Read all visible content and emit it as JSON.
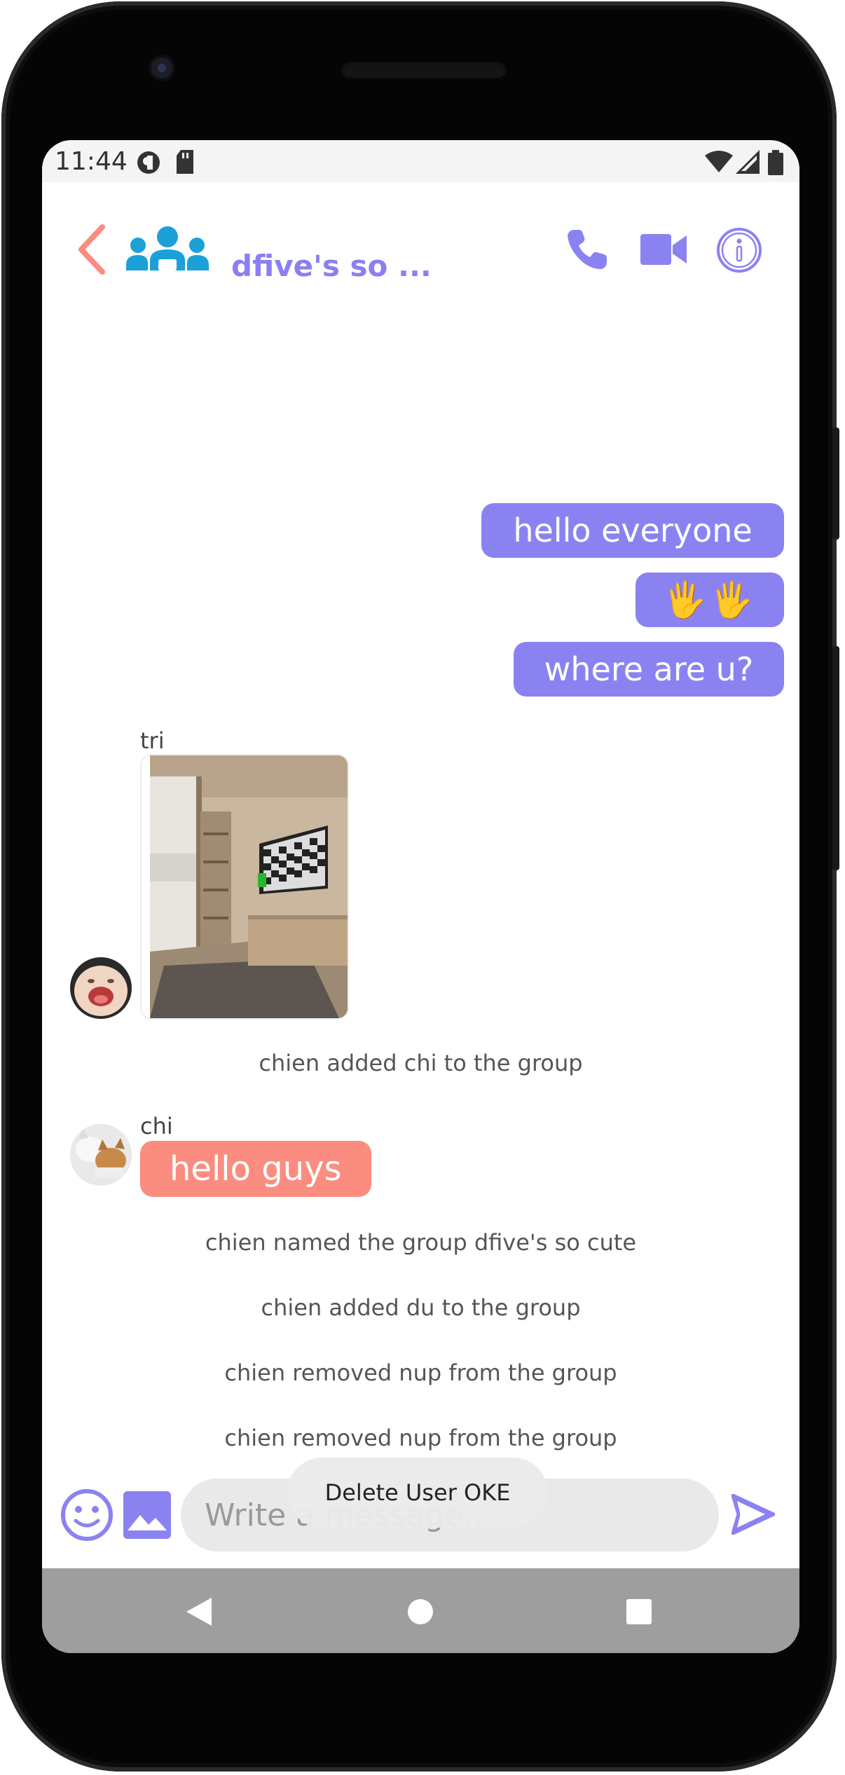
{
  "status_bar": {
    "time": "11:44"
  },
  "header": {
    "title": "dfive's so ..."
  },
  "messages_outgoing": [
    {
      "text": "hello everyone"
    },
    {
      "text": "🖐🖐"
    },
    {
      "text": "where are u?"
    }
  ],
  "messages_incoming": [
    {
      "sender": "tri",
      "type": "image"
    },
    {
      "sender": "chi",
      "text": "hello guys"
    }
  ],
  "system_messages": [
    "chien added chi to the group",
    "chien named the group dfive's so cute",
    "chien added du to the group",
    "chien removed nup from the group",
    "chien removed nup from the group"
  ],
  "composer": {
    "placeholder": "Write a message..."
  },
  "toast": {
    "text": "Delete User OKE"
  },
  "colors": {
    "accent": "#8b82f2",
    "back_arrow": "#fb8c80",
    "group_icon": "#1ba0d8",
    "incoming_bubble": "#fb8c80"
  }
}
